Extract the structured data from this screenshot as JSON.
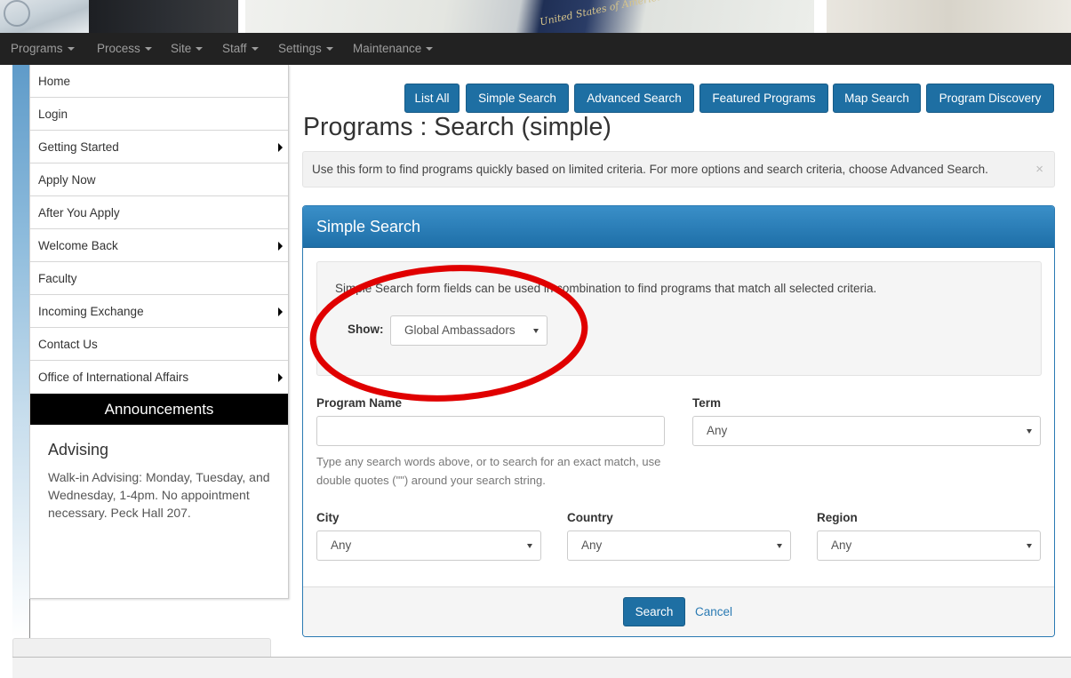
{
  "banner": {
    "passport_text": "United States of America"
  },
  "nav": {
    "items": [
      {
        "label": "Programs"
      },
      {
        "label": "Process"
      },
      {
        "label": "Site"
      },
      {
        "label": "Staff"
      },
      {
        "label": "Settings"
      },
      {
        "label": "Maintenance"
      }
    ]
  },
  "sidebar": {
    "items": [
      {
        "label": "Home",
        "has_submenu": false
      },
      {
        "label": "Login",
        "has_submenu": false
      },
      {
        "label": "Getting Started",
        "has_submenu": true
      },
      {
        "label": "Apply Now",
        "has_submenu": false
      },
      {
        "label": "After You Apply",
        "has_submenu": false
      },
      {
        "label": "Welcome Back",
        "has_submenu": true
      },
      {
        "label": "Faculty",
        "has_submenu": false
      },
      {
        "label": "Incoming Exchange",
        "has_submenu": true
      },
      {
        "label": "Contact Us",
        "has_submenu": false
      },
      {
        "label": "Office of International Affairs",
        "has_submenu": true
      }
    ],
    "announcements": {
      "header": "Announcements",
      "title": "Advising",
      "text": "Walk-in Advising: Monday, Tuesday, and Wednesday, 1-4pm. No appointment necessary. Peck Hall 207."
    }
  },
  "toolbar": {
    "buttons": [
      {
        "label": "List All"
      },
      {
        "label": "Simple Search"
      },
      {
        "label": "Advanced Search"
      },
      {
        "label": "Featured Programs"
      },
      {
        "label": "Map Search"
      },
      {
        "label": "Program Discovery"
      }
    ]
  },
  "page": {
    "title": "Programs : Search (simple)",
    "alert": "Use this form to find programs quickly based on limited criteria. For more options and search criteria, choose Advanced Search.",
    "alert_close": "×"
  },
  "panel": {
    "heading": "Simple Search",
    "well_text": "Simple Search form fields can be used in combination to find programs that match all selected criteria.",
    "show_label": "Show:",
    "show_value": "Global Ambassadors",
    "program_name_label": "Program Name",
    "program_name_value": "",
    "program_name_help": "Type any search words above, or to search for an exact match, use double quotes (\"\") around your search string.",
    "term_label": "Term",
    "term_value": "Any",
    "city_label": "City",
    "city_value": "Any",
    "country_label": "Country",
    "country_value": "Any",
    "region_label": "Region",
    "region_value": "Any",
    "search_label": "Search",
    "cancel_label": "Cancel"
  },
  "colors": {
    "primary": "#1e6fa3",
    "navbar": "#222222",
    "highlight_ring": "#e00000"
  }
}
